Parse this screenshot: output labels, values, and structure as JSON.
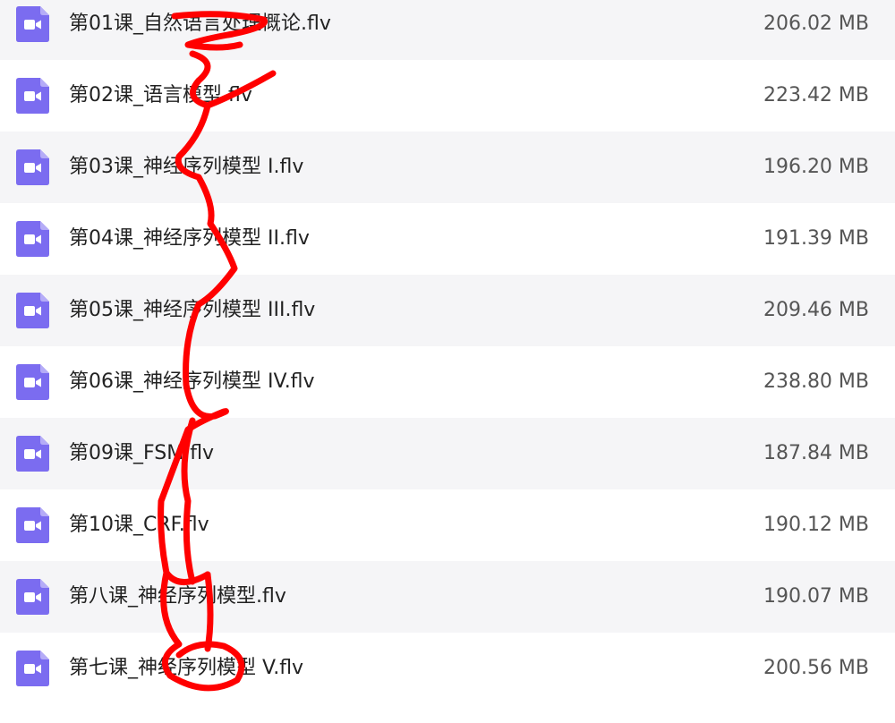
{
  "files": [
    {
      "name": "第01课_自然语言处理概论.flv",
      "size": "206.02 MB",
      "icon": "video-file-icon"
    },
    {
      "name": "第02课_语言模型.flv",
      "size": "223.42 MB",
      "icon": "video-file-icon"
    },
    {
      "name": "第03课_神经序列模型 I.flv",
      "size": "196.20 MB",
      "icon": "video-file-icon"
    },
    {
      "name": "第04课_神经序列模型 II.flv",
      "size": "191.39 MB",
      "icon": "video-file-icon"
    },
    {
      "name": "第05课_神经序列模型 III.flv",
      "size": "209.46 MB",
      "icon": "video-file-icon"
    },
    {
      "name": "第06课_神经序列模型 IV.flv",
      "size": "238.80 MB",
      "icon": "video-file-icon"
    },
    {
      "name": "第09课_FSM.flv",
      "size": "187.84 MB",
      "icon": "video-file-icon"
    },
    {
      "name": "第10课_CRF.flv",
      "size": "190.12 MB",
      "icon": "video-file-icon"
    },
    {
      "name": "第八课_神经序列模型.flv",
      "size": "190.07 MB",
      "icon": "video-file-icon"
    },
    {
      "name": "第七课_神经序列模型 V.flv",
      "size": "200.56 MB",
      "icon": "video-file-icon"
    }
  ],
  "colors": {
    "icon_purple": "#7b6cf0",
    "scribble_red": "#ff0000",
    "row_alt": "#f5f5f7"
  }
}
